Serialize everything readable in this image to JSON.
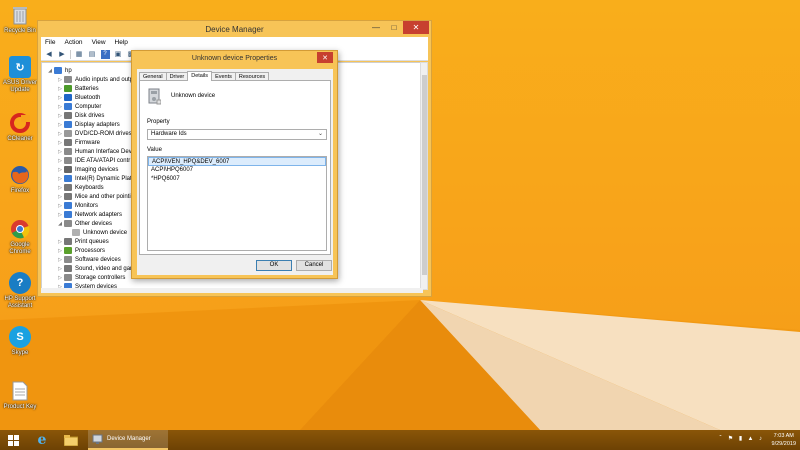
{
  "desktop": {
    "icons": [
      {
        "label": "Recycle Bin",
        "icon": "recycle-bin-icon"
      },
      {
        "label": "ASUS Driver Update",
        "icon": "driver-update-icon"
      },
      {
        "label": "CCleaner",
        "icon": "ccleaner-icon"
      },
      {
        "label": "Firefox",
        "icon": "firefox-icon"
      },
      {
        "label": "Google Chrome",
        "icon": "chrome-icon"
      },
      {
        "label": "HP Support Assistant",
        "icon": "hp-support-icon"
      },
      {
        "label": "Skype",
        "icon": "skype-icon"
      },
      {
        "label": "Product Key",
        "icon": "document-icon"
      }
    ]
  },
  "device_manager": {
    "title": "Device Manager",
    "menu": [
      "File",
      "Action",
      "View",
      "Help"
    ],
    "tree_root": "hp",
    "tree_items": [
      {
        "label": "Audio inputs and outp",
        "expanded": false,
        "icon_color": "#8a8a8a"
      },
      {
        "label": "Batteries",
        "expanded": false,
        "icon_color": "#4c9a2a"
      },
      {
        "label": "Bluetooth",
        "expanded": false,
        "icon_color": "#1f66c7"
      },
      {
        "label": "Computer",
        "expanded": false,
        "icon_color": "#3a7bd5"
      },
      {
        "label": "Disk drives",
        "expanded": false,
        "icon_color": "#777777"
      },
      {
        "label": "Display adapters",
        "expanded": false,
        "icon_color": "#3a7bd5"
      },
      {
        "label": "DVD/CD-ROM drives",
        "expanded": false,
        "icon_color": "#999999"
      },
      {
        "label": "Firmware",
        "expanded": false,
        "icon_color": "#777777"
      },
      {
        "label": "Human Interface Devic",
        "expanded": false,
        "icon_color": "#8a8a8a"
      },
      {
        "label": "IDE ATA/ATAPI contr",
        "expanded": false,
        "icon_color": "#8a8a8a"
      },
      {
        "label": "Imaging devices",
        "expanded": false,
        "icon_color": "#666666"
      },
      {
        "label": "Intel(R) Dynamic Platf",
        "expanded": false,
        "icon_color": "#3a7bd5"
      },
      {
        "label": "Keyboards",
        "expanded": false,
        "icon_color": "#777777"
      },
      {
        "label": "Mice and other pointin",
        "expanded": false,
        "icon_color": "#777777"
      },
      {
        "label": "Monitors",
        "expanded": false,
        "icon_color": "#3a7bd5"
      },
      {
        "label": "Network adapters",
        "expanded": false,
        "icon_color": "#3a7bd5"
      },
      {
        "label": "Other devices",
        "expanded": true,
        "icon_color": "#8a8a8a"
      },
      {
        "label": "Unknown device",
        "child": true,
        "icon_color": "#b0b0b0"
      },
      {
        "label": "Print queues",
        "expanded": false,
        "icon_color": "#777777"
      },
      {
        "label": "Processors",
        "expanded": false,
        "icon_color": "#5aa02c"
      },
      {
        "label": "Software devices",
        "expanded": false,
        "icon_color": "#8a8a8a"
      },
      {
        "label": "Sound, video and gam",
        "expanded": false,
        "icon_color": "#777777"
      },
      {
        "label": "Storage controllers",
        "expanded": false,
        "icon_color": "#8a8a8a"
      },
      {
        "label": "System devices",
        "expanded": false,
        "icon_color": "#3a7bd5"
      }
    ]
  },
  "properties": {
    "title": "Unknown device Properties",
    "tabs": [
      "General",
      "Driver",
      "Details",
      "Events",
      "Resources"
    ],
    "active_tab": 2,
    "device_name": "Unknown device",
    "property_label": "Property",
    "property_value": "Hardware Ids",
    "value_label": "Value",
    "values": [
      "ACPI\\VEN_HPQ&DEV_6007",
      "ACPI\\HPQ6007",
      "*HPQ6007"
    ],
    "ok_label": "OK",
    "cancel_label": "Cancel"
  },
  "taskbar": {
    "active_app": "Device Manager",
    "time": "7:03 AM",
    "date": "9/29/2019"
  },
  "colors": {
    "desktop_orange": "#f8a31a",
    "window_frame": "#f7c457",
    "taskbar": "#7a4a06",
    "close_red": "#c7402f",
    "selection_blue": "#dcecfc"
  }
}
